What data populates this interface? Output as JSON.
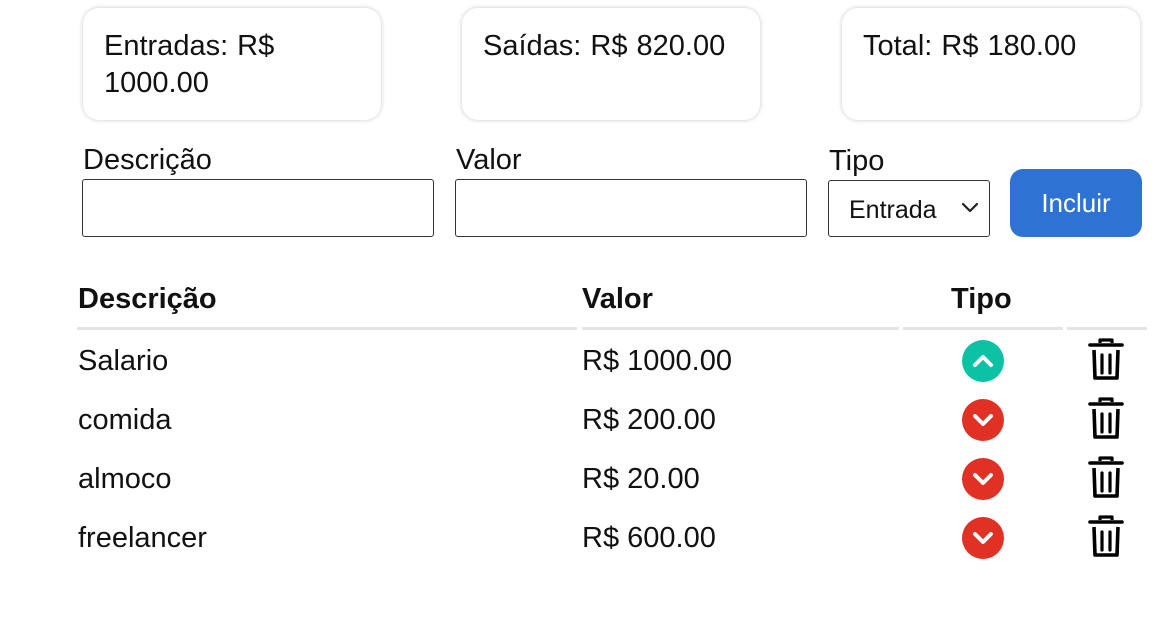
{
  "summary": {
    "entradas": "Entradas: R$ 1000.00",
    "saidas": "Saídas: R$ 820.00",
    "total": "Total: R$ 180.00"
  },
  "form": {
    "description_label": "Descrição",
    "description_value": "",
    "amount_label": "Valor",
    "amount_value": "",
    "type_label": "Tipo",
    "type_selected": "Entrada",
    "submit_label": "Incluir"
  },
  "table": {
    "headers": [
      "Descrição",
      "Valor",
      "Tipo"
    ],
    "rows": [
      {
        "description": "Salario",
        "amount": "R$ 1000.00",
        "type_icon": "arrow-up-circle-icon",
        "type": "entrada"
      },
      {
        "description": "comida",
        "amount": "R$ 200.00",
        "type_icon": "arrow-down-circle-icon",
        "type": "saida"
      },
      {
        "description": "almoco",
        "amount": "R$ 20.00",
        "type_icon": "arrow-down-circle-icon",
        "type": "saida"
      },
      {
        "description": "freelancer",
        "amount": "R$ 600.00",
        "type_icon": "arrow-down-circle-icon",
        "type": "saida"
      }
    ]
  },
  "colors": {
    "accent": "#2e73d3",
    "income": "#0cc2a5",
    "expense": "#e03124"
  }
}
